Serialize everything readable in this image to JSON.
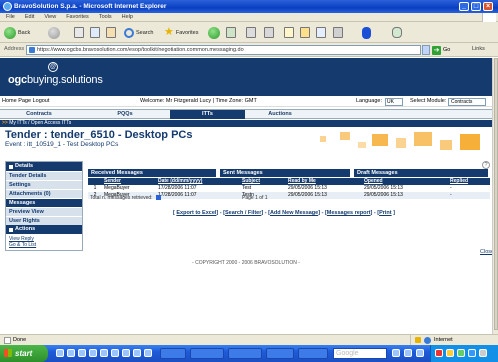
{
  "window": {
    "title": "BravoSolution S.p.a. - Microsoft Internet Explorer"
  },
  "menubar": [
    "File",
    "Edit",
    "View",
    "Favorites",
    "Tools",
    "Help"
  ],
  "toolbar": {
    "back_label": "Back",
    "search_label": "Search",
    "favorites_label": "Favorites"
  },
  "address": {
    "label": "Address",
    "url": "https://www.ogcbs.bravosolution.com/esop/toolkit/negotiation.common.messaging.do",
    "go_label": "Go",
    "links_label": "Links"
  },
  "site": {
    "logo_text_a": "ogc",
    "logo_text_b": "buying.solutions",
    "logo_mark": "@"
  },
  "userbar": {
    "home_logout": "Home Page  Logout",
    "welcome": "Welcome: Mr Fitzgerald Lucy | Time Zone: GMT",
    "language_label": "Language:",
    "language_value": "UK",
    "module_label": "Select Module:",
    "module_value": "Contracts"
  },
  "nav": {
    "tabs": [
      "Contracts",
      "PQQs",
      "ITTs",
      "Auctions"
    ]
  },
  "breadcrumb": {
    "arrow": ">>",
    "path": "My ITTs / Open Access ITTs"
  },
  "tender": {
    "title": "Tender : tender_6510 - Desktop PCs",
    "subtitle": "Event : itt_10519_1 - Test Desktop PCs"
  },
  "left_menu": {
    "details_heading": "Details",
    "items": [
      "Tender Details",
      "Settings",
      "Attachments (0)",
      "Messages",
      "Preview View",
      "User Rights"
    ],
    "actions_heading": "Actions",
    "actions": [
      "View Reply",
      "Go & To List"
    ]
  },
  "messages": {
    "tabs": [
      "Received Messages",
      "Sent Messages",
      "Draft Messages"
    ],
    "columns": [
      "",
      "Sender",
      "Date (dd/mm/yyyy)",
      "Subject",
      "Read by Me",
      "Opened",
      "Replied"
    ],
    "rows": [
      {
        "num": "1",
        "sender": "MegaBuyer",
        "date": "17/28/2006 11:07",
        "subject": "Test",
        "read_by_me": "29/05/2006 15:13",
        "opened": "29/05/2006 15:13",
        "replied": "-"
      },
      {
        "num": "2",
        "sender": "MegaBuyer",
        "date": "17/28/2006 11:07",
        "subject": "Testn",
        "read_by_me": "29/05/2006 15:13",
        "opened": "29/05/2006 15:13",
        "replied": "-"
      }
    ],
    "totals_text": "Total n. messages retrieved:",
    "page_text": "Page 1 of 1"
  },
  "actions": {
    "export": "Export to Excel",
    "search": "Search / Filter",
    "add": "Add New Message",
    "report": "Messages report",
    "print": "Print",
    "sep": "] - ["
  },
  "close_link": "Close",
  "footer": {
    "copyright": "- COPYRIGHT 2000 - 2006 BRAVOSOLUTION -"
  },
  "statusbar": {
    "status": "Done",
    "zone": "Internet"
  },
  "taskbar": {
    "start": "start",
    "search_placeholder": "Google",
    "tasks": [
      "",
      "",
      "",
      "",
      ""
    ]
  }
}
